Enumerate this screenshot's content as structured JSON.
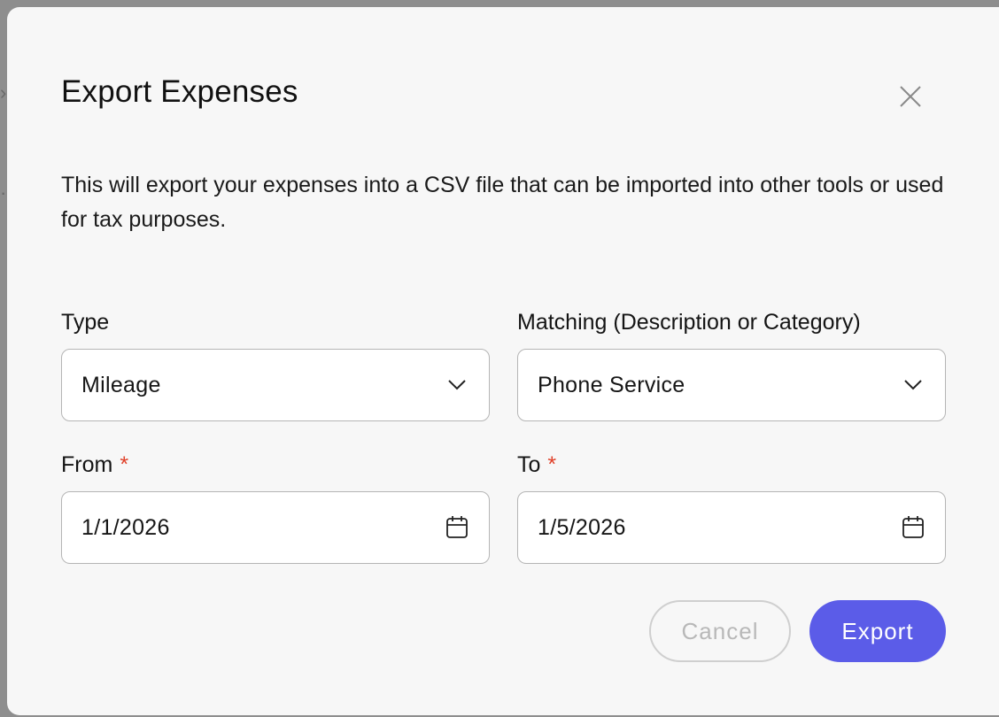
{
  "dialog": {
    "title": "Export Expenses",
    "description": "This will export your expenses into a CSV file that can be imported into other tools or used for tax purposes."
  },
  "form": {
    "type": {
      "label": "Type",
      "selected": "Mileage"
    },
    "matching": {
      "label": "Matching (Description or Category)",
      "selected": "Phone Service"
    },
    "from": {
      "label": "From",
      "required_mark": "*",
      "value": "1/1/2026"
    },
    "to": {
      "label": "To",
      "required_mark": "*",
      "value": "1/5/2026"
    }
  },
  "actions": {
    "cancel_label": "Cancel",
    "export_label": "Export"
  },
  "colors": {
    "accent": "#5b5ce8",
    "required": "#e0412a",
    "modal_bg": "#f7f7f7",
    "border": "#b5b5b5"
  },
  "icons": {
    "close": "close-icon",
    "dropdown": "chevron-down-icon",
    "date": "calendar-icon"
  }
}
